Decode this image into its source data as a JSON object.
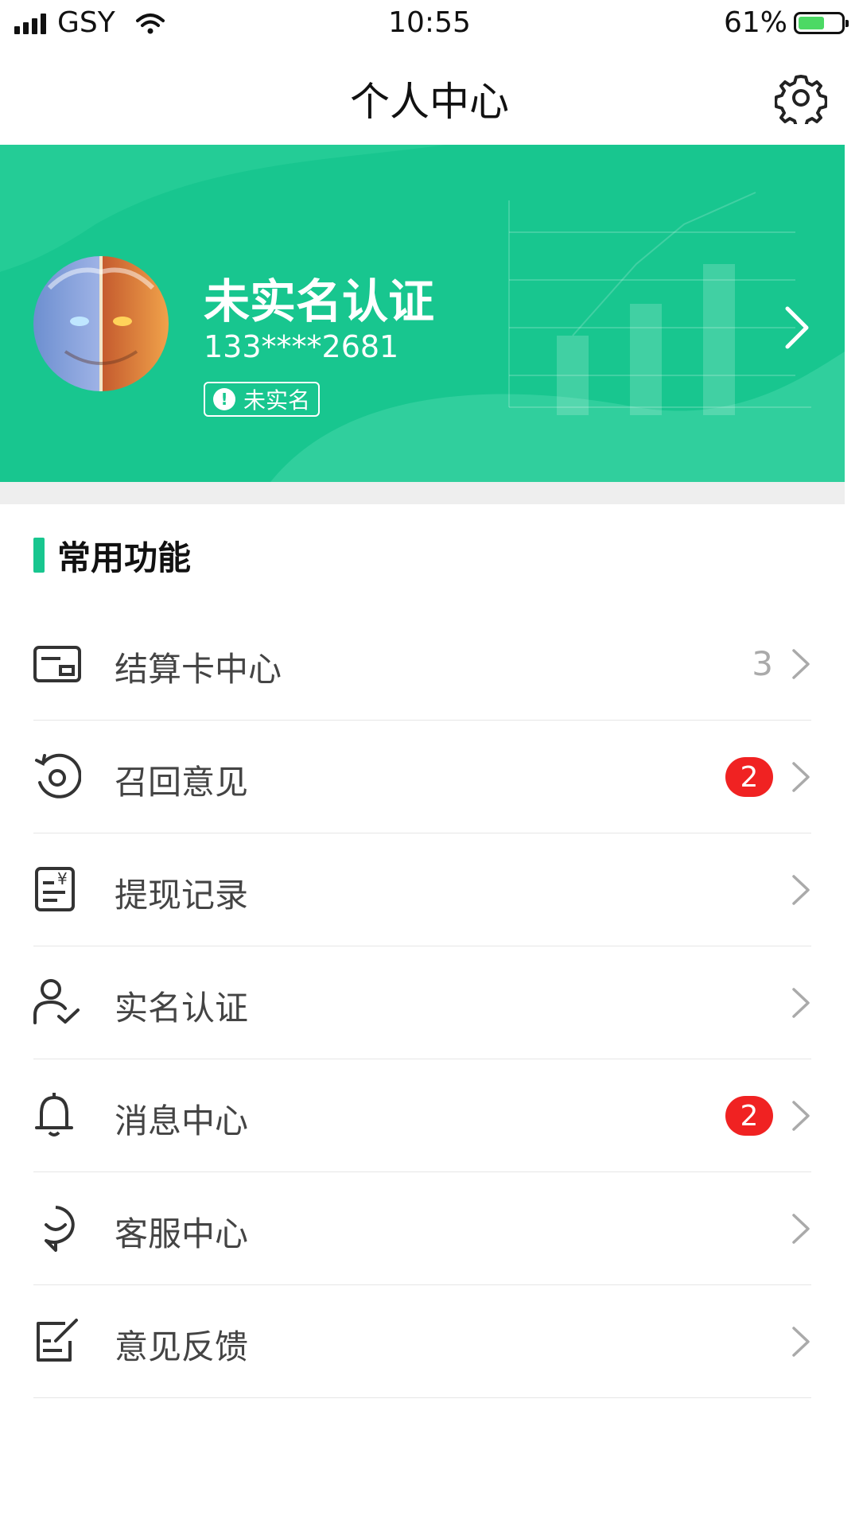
{
  "status_bar": {
    "carrier": "GSY",
    "time": "10:55",
    "battery_percent": "61%",
    "battery_level": 0.61,
    "icons": [
      "signal-icon",
      "wifi-icon",
      "battery-icon"
    ]
  },
  "nav": {
    "title": "个人中心",
    "settings_icon": "gear-icon"
  },
  "profile": {
    "name": "未实名认证",
    "phone": "133****2681",
    "verify_label": "未实名",
    "verify_icon": "exclamation-icon"
  },
  "section": {
    "title": "常用功能"
  },
  "menu": [
    {
      "label": "结算卡中心",
      "icon": "card-icon",
      "count": "3",
      "badge": null
    },
    {
      "label": "召回意见",
      "icon": "recall-icon",
      "count": null,
      "badge": "2"
    },
    {
      "label": "提现记录",
      "icon": "withdraw-record-icon",
      "count": null,
      "badge": null
    },
    {
      "label": "实名认证",
      "icon": "user-verify-icon",
      "count": null,
      "badge": null
    },
    {
      "label": "消息中心",
      "icon": "bell-icon",
      "count": null,
      "badge": "2"
    },
    {
      "label": "客服中心",
      "icon": "service-chat-icon",
      "count": null,
      "badge": null
    },
    {
      "label": "意见反馈",
      "icon": "feedback-edit-icon",
      "count": null,
      "badge": null
    }
  ],
  "colors": {
    "accent": "#18c68f",
    "badge": "#f02222",
    "text": "#444444",
    "muted": "#aaaaaa"
  }
}
